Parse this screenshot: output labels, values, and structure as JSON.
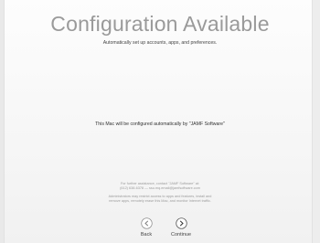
{
  "screen": {
    "title": "Configuration Available",
    "subtitle": "Automatically set up accounts, apps, and preferences.",
    "main_message": "This Mac will be configured automatically by \"JAMF Software\""
  },
  "footer": {
    "contact_line_1": "For further assistance, contact \"JAMF Software\" at:",
    "contact_line_2": "(612) 638-6378 — ssu.mq.email@jamfsoftware.com",
    "admin_line_1": "Administrators may restrict access to apps and features, install and",
    "admin_line_2": "remove apps, remotely erase this Mac, and monitor Internet traffic."
  },
  "navigation": {
    "back_label": "Back",
    "back_icon": "back-arrow-icon",
    "continue_label": "Continue",
    "continue_icon": "continue-arrow-icon"
  },
  "colors": {
    "title": "#9a9a9a",
    "background": "#ffffff",
    "fine_print": "#9c9c9c"
  }
}
